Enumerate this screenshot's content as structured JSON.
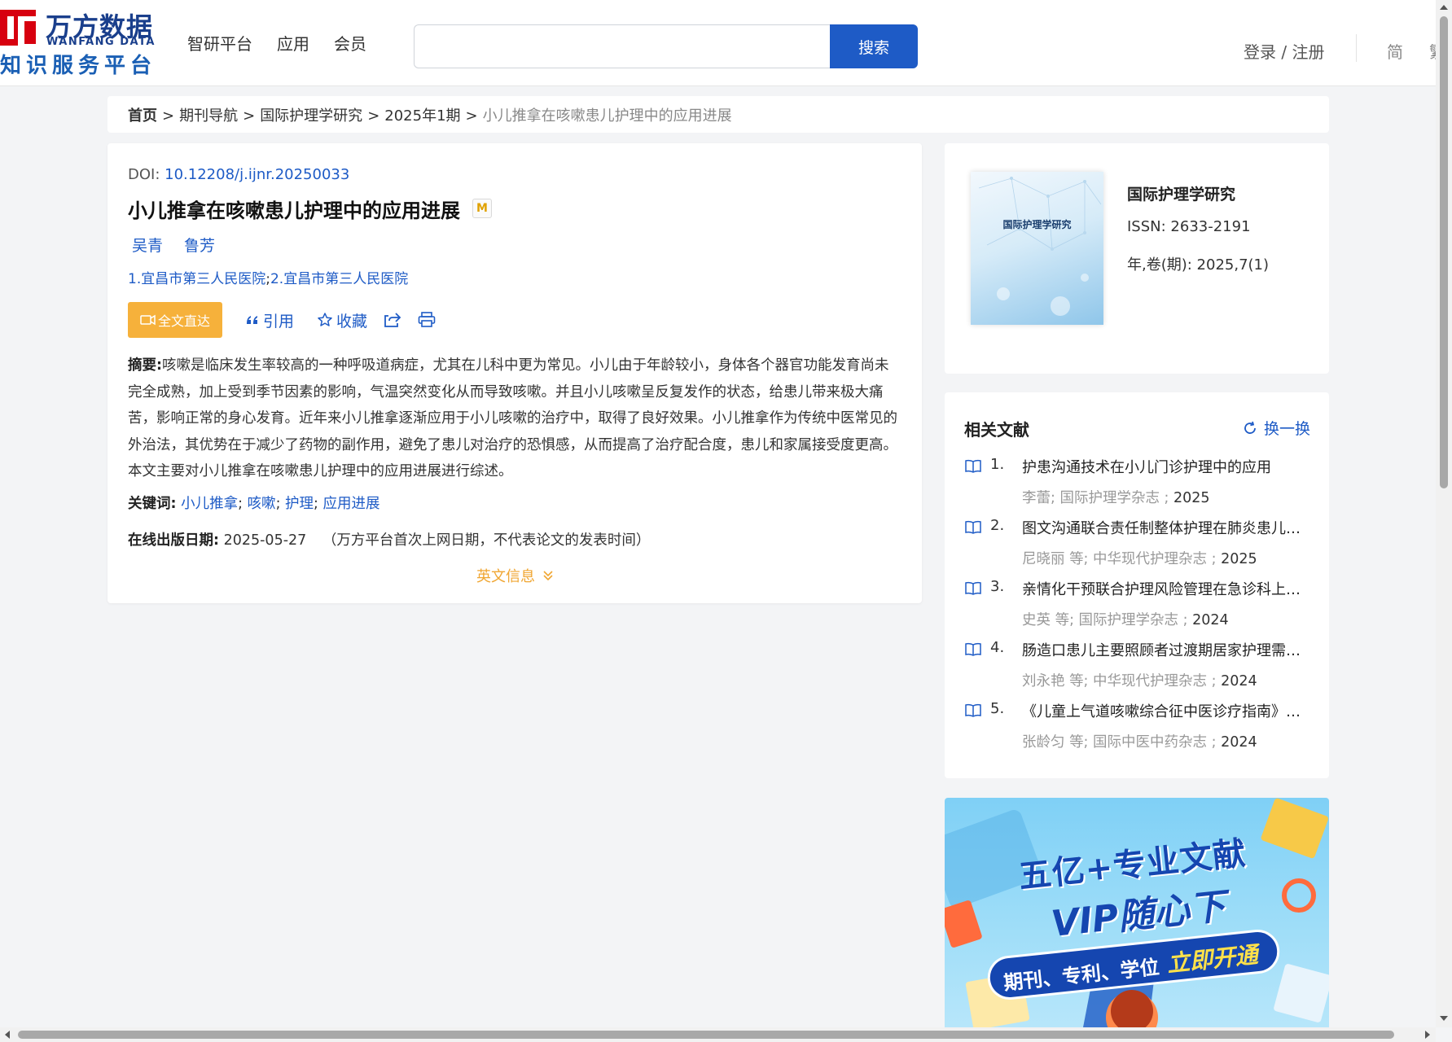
{
  "header": {
    "logo_cn": "万方数据",
    "logo_en": "WANFANG DATA",
    "logo_sub": "知识服务平台",
    "nav": [
      "智研平台",
      "应用",
      "会员"
    ],
    "search_placeholder": "",
    "search_button": "搜索",
    "login": "登录 / 注册",
    "lang_simplified": "简",
    "lang_traditional": "繁"
  },
  "breadcrumb": {
    "items": [
      "首页",
      "期刊导航",
      "国际护理学研究",
      "2025年1期"
    ],
    "current": "小儿推拿在咳嗽患儿护理中的应用进展",
    "separator": ">"
  },
  "article": {
    "doi_label": "DOI:",
    "doi_value": "10.12208/j.ijnr.20250033",
    "title": "小儿推拿在咳嗽患儿护理中的应用进展",
    "badge": "M",
    "authors": [
      "吴青",
      "鲁芳"
    ],
    "affiliations": [
      "1.宜昌市第三人民医院",
      "2.宜昌市第三人民医院"
    ],
    "affil_sep": ";",
    "fulltext_button": "全文直达",
    "cite_label": "引用",
    "favorite_label": "收藏",
    "abstract_label": "摘要:",
    "abstract_lines": [
      "咳嗽是临床发生率较高的一种呼吸道病症，尤其在儿科中更为常见。小儿由于年龄较小，身体各个器官功能发育尚未",
      "完全成熟，加上受到季节因素的影响，气温突然变化从而导致咳嗽。并且小儿咳嗽呈反复发作的状态，给患儿带来极大痛",
      "苦，影响正常的身心发育。近年来小儿推拿逐渐应用于小儿咳嗽的治疗中，取得了良好效果。小儿推拿作为传统中医常见的",
      "外治法，其优势在于减少了药物的副作用，避免了患儿对治疗的恐惧感，从而提高了治疗配合度，患儿和家属接受度更高。",
      "本文主要对小儿推拿在咳嗽患儿护理中的应用进展进行综述。"
    ],
    "keywords_label": "关键词:",
    "keywords": [
      "小儿推拿",
      "咳嗽",
      "护理",
      "应用进展"
    ],
    "keyword_sep": ";",
    "pubdate_label": "在线出版日期:",
    "pubdate": "2025-05-27",
    "pubdate_note": "（万方平台首次上网日期，不代表论文的发表时间）",
    "english_info": "英文信息"
  },
  "journal": {
    "cover_title": "国际护理学研究",
    "name": "国际护理学研究",
    "issn": "ISSN:  2633-2191",
    "volume": "年,卷(期):  2025,7(1)"
  },
  "related": {
    "title": "相关文献",
    "refresh": "换一换",
    "items": [
      {
        "num": "1.",
        "title": "护患沟通技术在小儿门诊护理中的应用",
        "meta": "李蕾; 国际护理学杂志 ;",
        "year": "2025"
      },
      {
        "num": "2.",
        "title": "图文沟通联合责任制整体护理在肺炎患儿中...",
        "meta": "尼晓丽  等;  中华现代护理杂志 ;",
        "year": "2025"
      },
      {
        "num": "3.",
        "title": "亲情化干预联合护理风险管理在急诊科上呼...",
        "meta": "史英  等;  国际护理学杂志 ;",
        "year": "2024"
      },
      {
        "num": "4.",
        "title": "肠造口患儿主要照顾者过渡期居家护理需求...",
        "meta": "刘永艳  等;  中华现代护理杂志 ;",
        "year": "2024"
      },
      {
        "num": "5.",
        "title": "《儿童上气道咳嗽综合征中医诊疗指南》计...",
        "meta": "张龄匀  等;  国际中医中药杂志 ;",
        "year": "2024"
      }
    ]
  },
  "banner": {
    "line1": "五亿+专业文献",
    "line2": "VIP随心下",
    "pill_left": "期刊、专利、学位",
    "pill_right": "立即开通"
  },
  "colors": {
    "primary": "#1e5bc6",
    "accent_orange": "#f6b13b",
    "logo_red": "#d7000f",
    "logo_blue": "#1a3f8c"
  }
}
